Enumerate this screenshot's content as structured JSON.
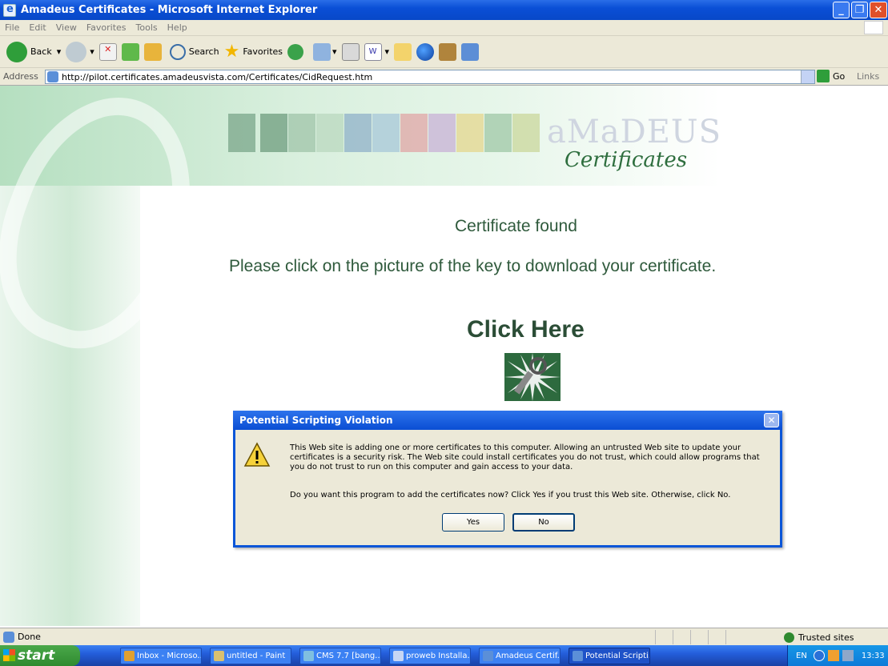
{
  "window": {
    "title": "Amadeus Certificates - Microsoft Internet Explorer"
  },
  "menu": [
    "File",
    "Edit",
    "View",
    "Favorites",
    "Tools",
    "Help"
  ],
  "toolbar": {
    "back": "Back",
    "search": "Search",
    "favorites": "Favorites"
  },
  "address": {
    "label": "Address",
    "url": "http://pilot.certificates.amadeusvista.com/Certificates/CidRequest.htm",
    "go": "Go",
    "links": "Links"
  },
  "page": {
    "logo_word": "aMaDEUS",
    "logo_sub": "Certificates",
    "found": "Certificate found",
    "please": "Please click on the picture of the key to download your certificate.",
    "click_here": "Click Here"
  },
  "dialog": {
    "title": "Potential Scripting Violation",
    "message": "This Web site is adding one or more certificates to this computer. Allowing an untrusted Web site to update your certificates is a security risk. The Web site could install certificates you do not trust, which could allow programs that you do not trust to run on this computer and gain access to your data.",
    "question": "Do you want this program to add the certificates now? Click Yes if you trust this Web site. Otherwise, click No.",
    "yes": "Yes",
    "no": "No"
  },
  "status": {
    "text": "Done",
    "zone": "Trusted sites"
  },
  "taskbar": {
    "start": "start",
    "tasks": [
      "Inbox - Microso...",
      "untitled - Paint",
      "CMS 7.7 [bang...",
      "proweb Installa...",
      "Amadeus Certif...",
      "Potential Scripti..."
    ],
    "lang": "EN",
    "clock": "13:33"
  },
  "colors": {
    "title_blue": "#0a4fd6",
    "page_green": "#2f5a3c",
    "start_green": "#2f8a2f"
  }
}
